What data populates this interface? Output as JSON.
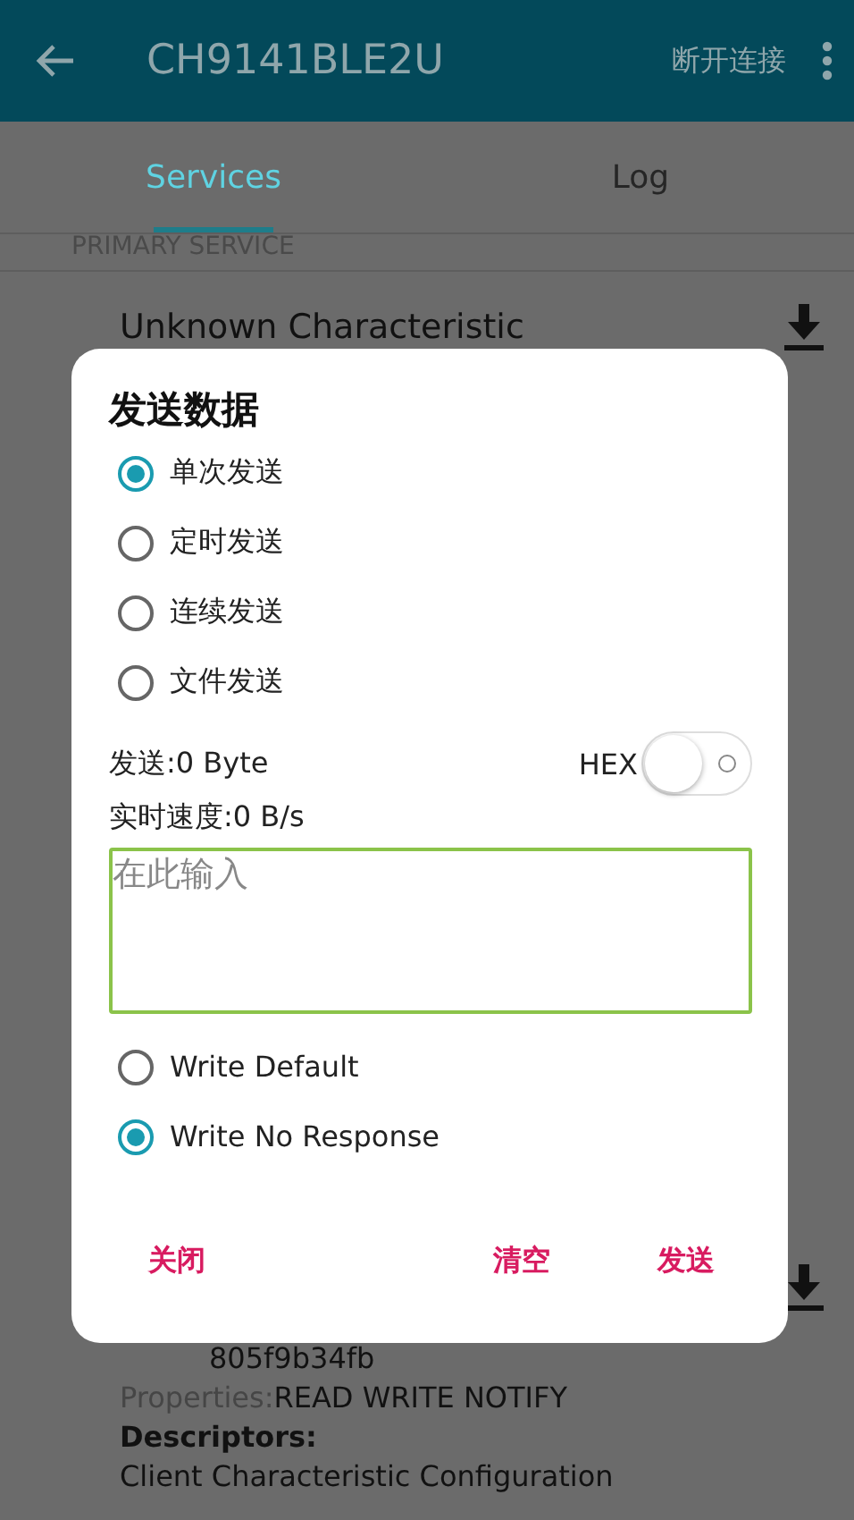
{
  "app_bar": {
    "title": "CH9141BLE2U",
    "action": "断开连接"
  },
  "tabs": [
    {
      "label": "Services",
      "selected": true
    },
    {
      "label": "Log",
      "selected": false
    }
  ],
  "background": {
    "section_header": "PRIMARY SERVICE",
    "characteristic_name": "Unknown Characteristic",
    "uuid_tail": "805f9b34fb",
    "properties_label": "Properties:",
    "properties_value": "READ WRITE NOTIFY",
    "descriptors_label": "Descriptors:",
    "descriptor_name": "Client Characteristic Configuration"
  },
  "dialog": {
    "title": "发送数据",
    "send_modes": [
      {
        "label": "单次发送",
        "selected": true
      },
      {
        "label": "定时发送",
        "selected": false
      },
      {
        "label": "连续发送",
        "selected": false
      },
      {
        "label": "文件发送",
        "selected": false
      }
    ],
    "sent_count": "发送:0 Byte",
    "hex": {
      "label": "HEX",
      "on": false
    },
    "speed": "实时速度:0 B/s",
    "input": {
      "placeholder": "在此输入"
    },
    "write_modes": [
      {
        "label": "Write Default",
        "selected": false
      },
      {
        "label": "Write No Response",
        "selected": true
      }
    ],
    "buttons": [
      "关闭",
      "清空",
      "发送"
    ]
  }
}
